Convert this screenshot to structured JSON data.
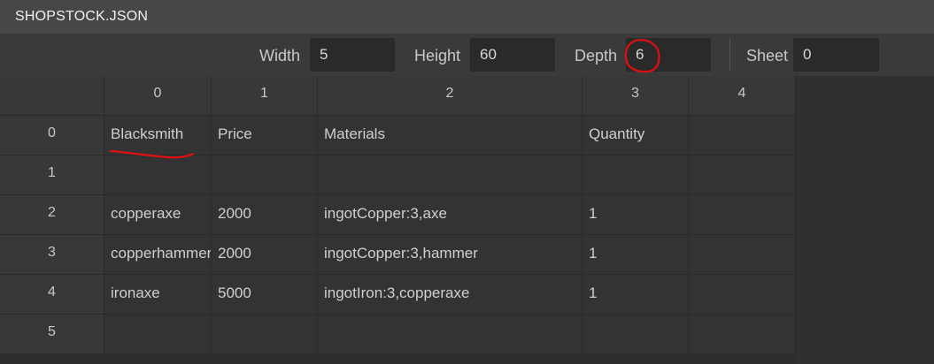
{
  "window": {
    "title": "SHOPSTOCK.JSON"
  },
  "toolbar": {
    "width_label": "Width",
    "width_value": "5",
    "height_label": "Height",
    "height_value": "60",
    "depth_label": "Depth",
    "depth_value": "6",
    "sheet_label": "Sheet",
    "sheet_value": "0"
  },
  "grid": {
    "column_headers": [
      "0",
      "1",
      "2",
      "3",
      "4"
    ],
    "row_headers": [
      "0",
      "1",
      "2",
      "3",
      "4",
      "5"
    ],
    "rows": [
      [
        "Blacksmith",
        "Price",
        "Materials",
        "Quantity",
        ""
      ],
      [
        "",
        "",
        "",
        "",
        ""
      ],
      [
        "copperaxe",
        "2000",
        "ingotCopper:3,axe",
        "1",
        ""
      ],
      [
        "copperhammer",
        "2000",
        "ingotCopper:3,hammer",
        "1",
        ""
      ],
      [
        "ironaxe",
        "5000",
        "ingotIron:3,copperaxe",
        "1",
        ""
      ],
      [
        "",
        "",
        "",
        "",
        ""
      ]
    ]
  },
  "annotations": {
    "color": "#e01010"
  }
}
